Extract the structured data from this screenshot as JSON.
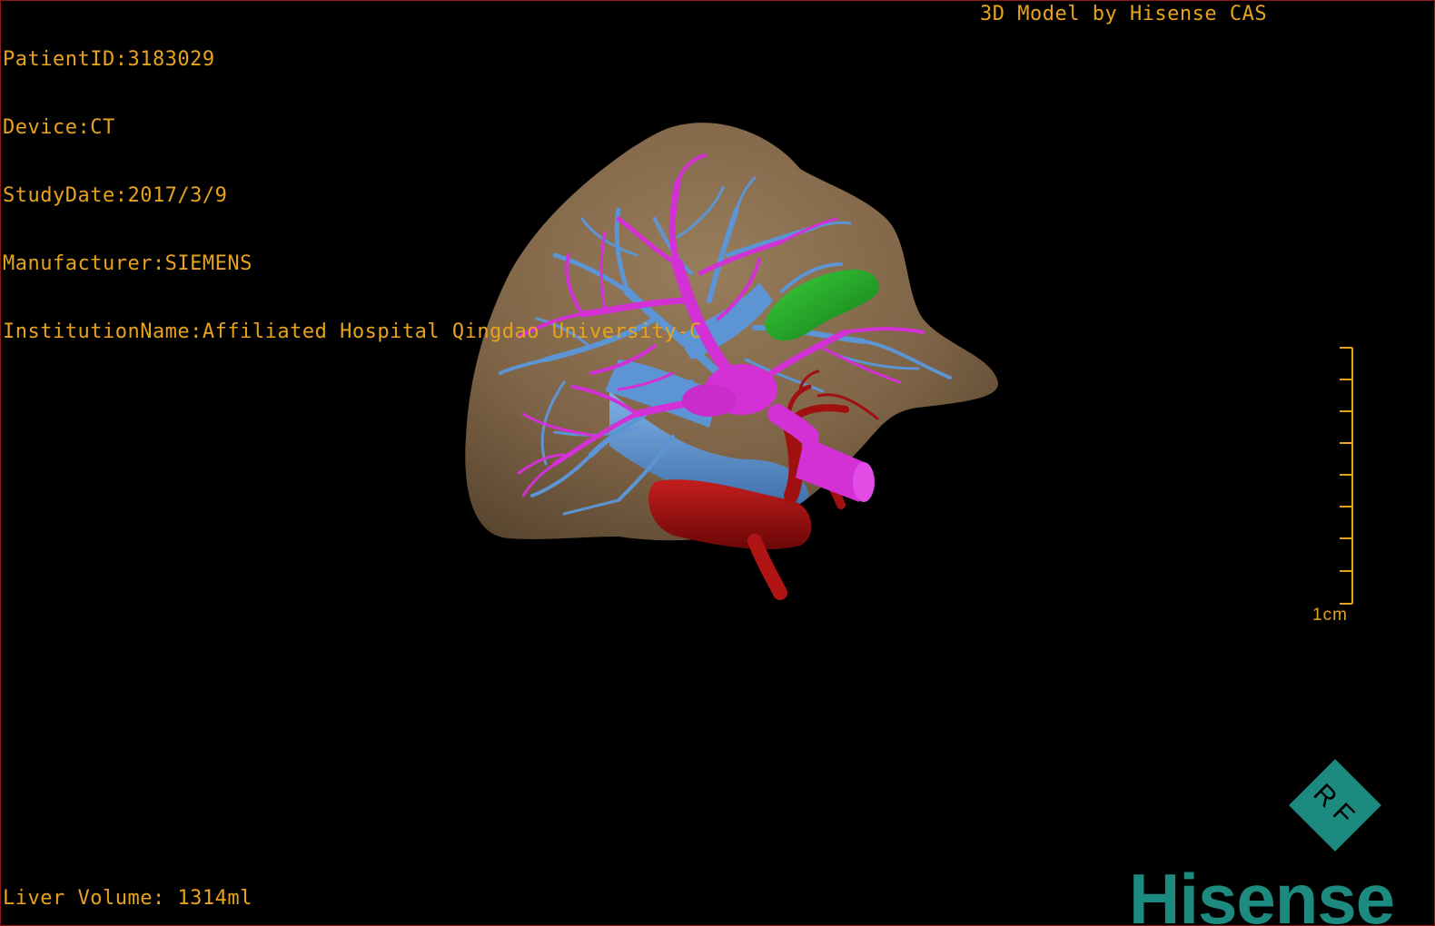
{
  "header": {
    "patient_id": "PatientID:3183029",
    "device": "Device:CT",
    "study_date": "StudyDate:2017/3/9",
    "manufacturer": "Manufacturer:SIEMENS",
    "institution": "InstitutionName:Affiliated Hospital Qingdao University-C",
    "credit": "3D Model by Hisense CAS"
  },
  "footer": {
    "liver_volume": "Liver Volume: 1314ml"
  },
  "scale_bar": {
    "label": "1cm"
  },
  "logo": {
    "badge_text": "RF",
    "brand": "Hisense"
  },
  "colors": {
    "background": "#000000",
    "overlay_text": "#e8a31e",
    "liver": "#8c7254",
    "portal_vein": "#d330d6",
    "hepatic_vein": "#5d94d4",
    "artery": "#a01010",
    "gallbladder": "#1f9d22",
    "brand": "#1d8a80"
  },
  "model": {
    "structures": [
      "liver",
      "portal-vein",
      "hepatic-vein",
      "hepatic-artery",
      "inferior-vena-cava",
      "gallbladder"
    ]
  }
}
